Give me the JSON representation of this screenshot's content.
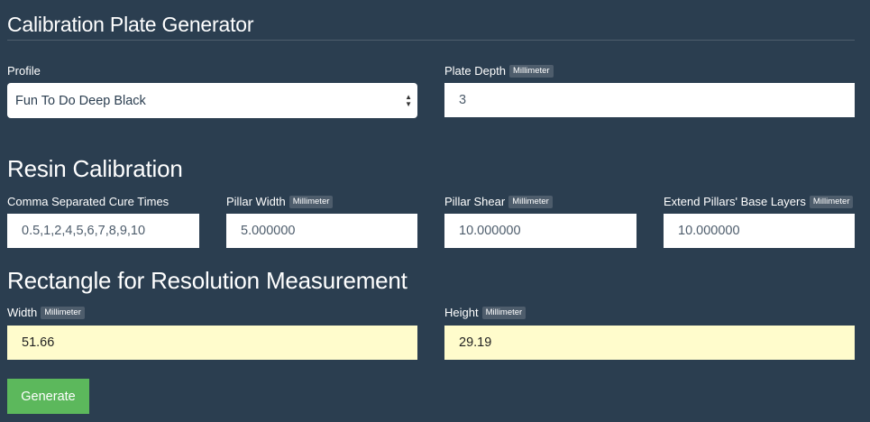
{
  "page_title": "Calibration Plate Generator",
  "unit_label": "Millimeter",
  "profile": {
    "label": "Profile",
    "selected": "Fun To Do Deep Black"
  },
  "plate_depth": {
    "label": "Plate Depth",
    "value": "3"
  },
  "resin": {
    "heading": "Resin Calibration",
    "cure_times": {
      "label": "Comma Separated Cure Times",
      "value": "0.5,1,2,4,5,6,7,8,9,10"
    },
    "pillar_width": {
      "label": "Pillar Width",
      "value": "5.000000"
    },
    "pillar_shear": {
      "label": "Pillar Shear",
      "value": "10.000000"
    },
    "extend_base": {
      "label": "Extend Pillars' Base Layers",
      "value": "10.000000"
    }
  },
  "rectangle": {
    "heading": "Rectangle for Resolution Measurement",
    "width": {
      "label": "Width",
      "value": "51.66"
    },
    "height": {
      "label": "Height",
      "value": "29.19"
    }
  },
  "generate_label": "Generate",
  "colors": {
    "background": "#2b3e50",
    "badge": "#4e5d6c",
    "highlight_field": "#fffccc",
    "generate_button": "#5cb85c"
  }
}
